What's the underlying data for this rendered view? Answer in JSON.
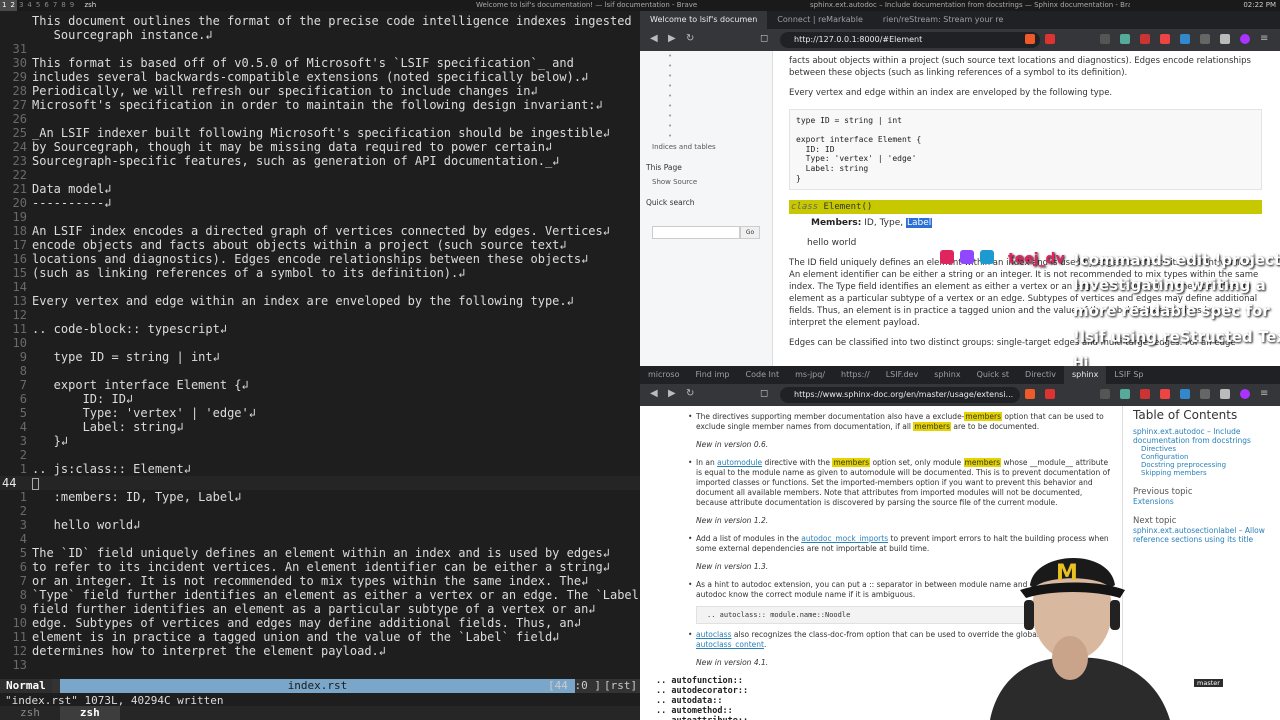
{
  "topbar": {
    "workspaces": [
      "1",
      "2",
      "3",
      "4",
      "5",
      "6",
      "7",
      "8",
      "9"
    ],
    "active_workspace": "2",
    "terminal_title": "zsh",
    "win_title_1": "Welcome to lsif's documentation! — lsif documentation - Brave",
    "win_title_2": "sphinx.ext.autodoc – Include documentation from docstrings — Sphinx documentation - Brave",
    "clock": "02:22 PM"
  },
  "editor": {
    "lines": [
      {
        "num": "",
        "text": "This document outlines the format of the precise code intelligence indexes ingested by a"
      },
      {
        "num": "",
        "text": "   Sourcegraph instance.↲"
      },
      {
        "num": "31",
        "text": ""
      },
      {
        "num": "30",
        "text": "This format is based off of v0.5.0 of Microsoft's `LSIF specification`_ and"
      },
      {
        "num": "29",
        "text": "includes several backwards-compatible extensions (noted specifically below).↲"
      },
      {
        "num": "28",
        "text": "Periodically, we will refresh our specification to include changes in↲"
      },
      {
        "num": "27",
        "text": "Microsoft's specification in order to maintain the following design invariant:↲"
      },
      {
        "num": "26",
        "text": ""
      },
      {
        "num": "25",
        "text": "_An LSIF indexer built following Microsoft's specification should be ingestible↲"
      },
      {
        "num": "24",
        "text": "by Sourcegraph, though it may be missing data required to power certain↲"
      },
      {
        "num": "23",
        "text": "Sourcegraph-specific features, such as generation of API documentation._↲"
      },
      {
        "num": "22",
        "text": ""
      },
      {
        "num": "21",
        "text": "Data model↲"
      },
      {
        "num": "20",
        "text": "----------↲"
      },
      {
        "num": "19",
        "text": ""
      },
      {
        "num": "18",
        "text": "An LSIF index encodes a directed graph of vertices connected by edges. Vertices↲"
      },
      {
        "num": "17",
        "text": "encode objects and facts about objects within a project (such source text↲"
      },
      {
        "num": "16",
        "text": "locations and diagnostics). Edges encode relationships between these objects↲"
      },
      {
        "num": "15",
        "text": "(such as linking references of a symbol to its definition).↲"
      },
      {
        "num": "14",
        "text": ""
      },
      {
        "num": "13",
        "text": "Every vertex and edge within an index are enveloped by the following type.↲"
      },
      {
        "num": "12",
        "text": ""
      },
      {
        "num": "11",
        "text": ".. code-block:: typescript↲"
      },
      {
        "num": "10",
        "text": ""
      },
      {
        "num": "9",
        "text": "   type ID = string | int↲"
      },
      {
        "num": "8",
        "text": ""
      },
      {
        "num": "7",
        "text": "   export interface Element {↲"
      },
      {
        "num": "6",
        "text": "       ID: ID↲"
      },
      {
        "num": "5",
        "text": "       Type: 'vertex' | 'edge'↲"
      },
      {
        "num": "4",
        "text": "       Label: string↲"
      },
      {
        "num": "3",
        "text": "   }↲"
      },
      {
        "num": "2",
        "text": ""
      },
      {
        "num": "1",
        "text": ".. js:class:: Element↲"
      },
      {
        "num": "44",
        "text": ""
      },
      {
        "num": "1",
        "text": "   :members: ID, Type, Label↲"
      },
      {
        "num": "2",
        "text": ""
      },
      {
        "num": "3",
        "text": "   hello world↲"
      },
      {
        "num": "4",
        "text": ""
      },
      {
        "num": "5",
        "text": "The `ID` field uniquely defines an element within an index and is used by edges↲"
      },
      {
        "num": "6",
        "text": "to refer to its incident vertices. An element identifier can be either a string↲"
      },
      {
        "num": "7",
        "text": "or an integer. It is not recommended to mix types within the same index. The↲"
      },
      {
        "num": "8",
        "text": "`Type` field further identifies an element as either a vertex or an edge. The `Label`↲"
      },
      {
        "num": "9",
        "text": "field further identifies an element as a particular subtype of a vertex or an↲"
      },
      {
        "num": "10",
        "text": "edge. Subtypes of vertices and edges may define additional fields. Thus, an↲"
      },
      {
        "num": "11",
        "text": "element is in practice a tagged union and the value of the `Label` field↲"
      },
      {
        "num": "12",
        "text": "determines how to interpret the element payload.↲"
      },
      {
        "num": "13",
        "text": ""
      }
    ],
    "mode": "Normal",
    "filename": "index.rst",
    "position": "[44 :0 ]",
    "filetype": "[rst]",
    "cmdline": "\"index.rst\" 1073L, 40294C written",
    "tmux_windows": [
      "zsh",
      "zsh"
    ]
  },
  "browser1": {
    "tabs": [
      "Welcome to lsif's documen",
      "Connect | reMarkable",
      "rien/reStream: Stream your re"
    ],
    "url": "http://127.0.0.1:8000/#Element",
    "sidebar": {
      "indices_label": "Indices and tables",
      "this_page": "This Page",
      "show_source": "Show Source",
      "quick_search": "Quick search",
      "go": "Go"
    },
    "content": {
      "p_top": "facts about objects within a project (such source text locations and diagnostics). Edges encode relationships between these objects (such as linking references of a symbol to its definition).",
      "p_envelope": "Every vertex and edge within an index are enveloped by the following type.",
      "code": [
        "type ID = string | int",
        "",
        "export interface Element {",
        "  ID: ID",
        "  Type: 'vertex' | 'edge'",
        "  Label: string",
        "}"
      ],
      "sig_kw": "class",
      "sig_name": "Element()",
      "members_label": "Members:",
      "members_value": "ID, Type,",
      "members_hl": "Label",
      "hello": "hello world",
      "p_id": "The ID field uniquely defines an element within an index and is used by edges to refer to its incident vertices. An element identifier can be either a string or an integer. It is not recommended to mix types within the same index. The Type field identifies an element as either a vertex or an edge. The Label field further identifies an element as a particular subtype of a vertex or an edge. Subtypes of vertices and edges may define additional fields. Thus, an element is in practice a tagged union and the value of the Label field determines how to interpret the element payload.",
      "p_edges": "Edges can be classified into two distinct groups: single-target edges and multi-target edges. For an edge"
    }
  },
  "overlay": {
    "username": "teej_dv",
    "line1": "!commands edit !project",
    "line2": "Investigating writing a",
    "line3": "more readable spec for",
    "line4": "!lsif using reStructed Text",
    "hi": "Hi"
  },
  "browser2": {
    "tabs": [
      "microso",
      "Find imp",
      "Code Int",
      "ms-jpq/",
      "https://",
      "LSIF.dev",
      "sphinx",
      "Quick st",
      "Directiv",
      "sphinx",
      "LSIF Sp"
    ],
    "url": "https://www.sphinx-doc.org/en/master/usage/extensi...",
    "toc": {
      "title": "Table of Contents",
      "main_link": "sphinx.ext.autodoc – Include documentation from docstrings",
      "subs": [
        "Directives",
        "Configuration",
        "Docstring preprocessing",
        "Skipping members"
      ],
      "prev_label": "Previous topic",
      "prev_link": "Extensions",
      "next_label": "Next topic",
      "next_link": "sphinx.ext.autosectionlabel – Allow reference sections using its title"
    },
    "content": {
      "p1a": "The directives supporting member documentation also have a exclude-",
      "p1_hl": "members",
      "p1b": "option that can be used to exclude single member names from documentation, if all",
      "p1c": "are to be documented.",
      "v06": "New in version 0.6.",
      "p2a": "In an",
      "p2_link": "automodule",
      "p2b": "directive with the",
      "p2c": "option set, only module",
      "p2d": "whose __module__ attribute is equal to the module name as given to automodule will be documented. This is to prevent documentation of imported classes or functions. Set the imported-members option if you want to prevent this behavior and document all available members. Note that attributes from imported modules will not be documented, because attribute documentation is discovered by parsing the source file of the current module.",
      "v12": "New in version 1.2.",
      "p3a": "Add a list of modules in the",
      "p3_link": "autodoc_mock_imports",
      "p3b": "to prevent import errors to halt the building process when some external dependencies are not importable at build time.",
      "v13": "New in version 1.3.",
      "p4": "As a hint to autodoc extension, you can put a :: separator in between module name and object name to let autodoc know the correct module name if it is ambiguous.",
      "code": ".. autoclass:: module.name::Noodle",
      "p5_link": "autoclass",
      "p5a": "also recognizes the class-doc-from option that can be used to override the global value of",
      "p5_link2": "autoclass_content",
      "v41": "New in version 4.1.",
      "directives": [
        ".. autofunction::",
        ".. autodecorator::",
        ".. autodata::",
        ".. automethod::",
        ".. autoattribute::"
      ]
    },
    "git_branch": "master"
  }
}
